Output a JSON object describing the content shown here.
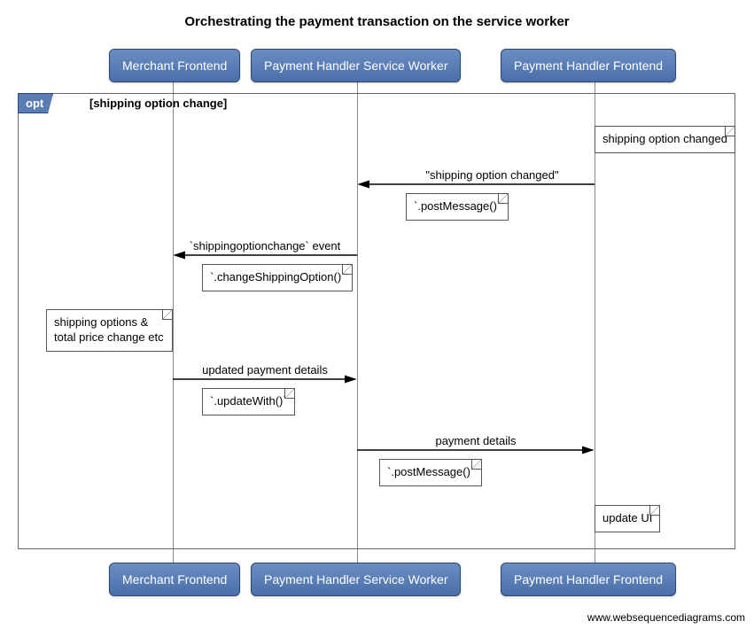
{
  "title": "Orchestrating the payment transaction on the service worker",
  "participants": {
    "merchant": "Merchant Frontend",
    "sw": "Payment Handler Service Worker",
    "handler_fe": "Payment Handler Frontend"
  },
  "opt": {
    "label": "opt",
    "guard": "[shipping option change]"
  },
  "notes": {
    "shipping_opt_changed": "shipping option changed",
    "post_message_1": "`.postMessage()`",
    "change_shipping": "`.changeShippingOption()`",
    "price_change": "shipping options & total price change etc",
    "update_with": "`.updateWith()`",
    "post_message_2": "`.postMessage()`",
    "update_ui": "update UI"
  },
  "messages": {
    "msg1": "\"shipping option changed\"",
    "msg2": "`shippingoptionchange` event",
    "msg3": "updated payment details",
    "msg4": "payment details"
  },
  "attribution": "www.websequencediagrams.com",
  "chart_data": {
    "type": "sequence-diagram",
    "title": "Orchestrating the payment transaction on the service worker",
    "participants": [
      "Merchant Frontend",
      "Payment Handler Service Worker",
      "Payment Handler Frontend"
    ],
    "fragments": [
      {
        "type": "opt",
        "guard": "shipping option change",
        "steps": [
          {
            "type": "note",
            "over": "Payment Handler Frontend",
            "text": "shipping option changed"
          },
          {
            "type": "message",
            "from": "Payment Handler Frontend",
            "to": "Payment Handler Service Worker",
            "label": "\"shipping option changed\"",
            "note": "`.postMessage()`"
          },
          {
            "type": "message",
            "from": "Payment Handler Service Worker",
            "to": "Merchant Frontend",
            "label": "`shippingoptionchange` event",
            "note": "`.changeShippingOption()`"
          },
          {
            "type": "note",
            "over": "Merchant Frontend",
            "text": "shipping options & total price change etc"
          },
          {
            "type": "message",
            "from": "Merchant Frontend",
            "to": "Payment Handler Service Worker",
            "label": "updated payment details",
            "note": "`.updateWith()`"
          },
          {
            "type": "message",
            "from": "Payment Handler Service Worker",
            "to": "Payment Handler Frontend",
            "label": "payment details",
            "note": "`.postMessage()`"
          },
          {
            "type": "note",
            "over": "Payment Handler Frontend",
            "text": "update UI"
          }
        ]
      }
    ]
  }
}
